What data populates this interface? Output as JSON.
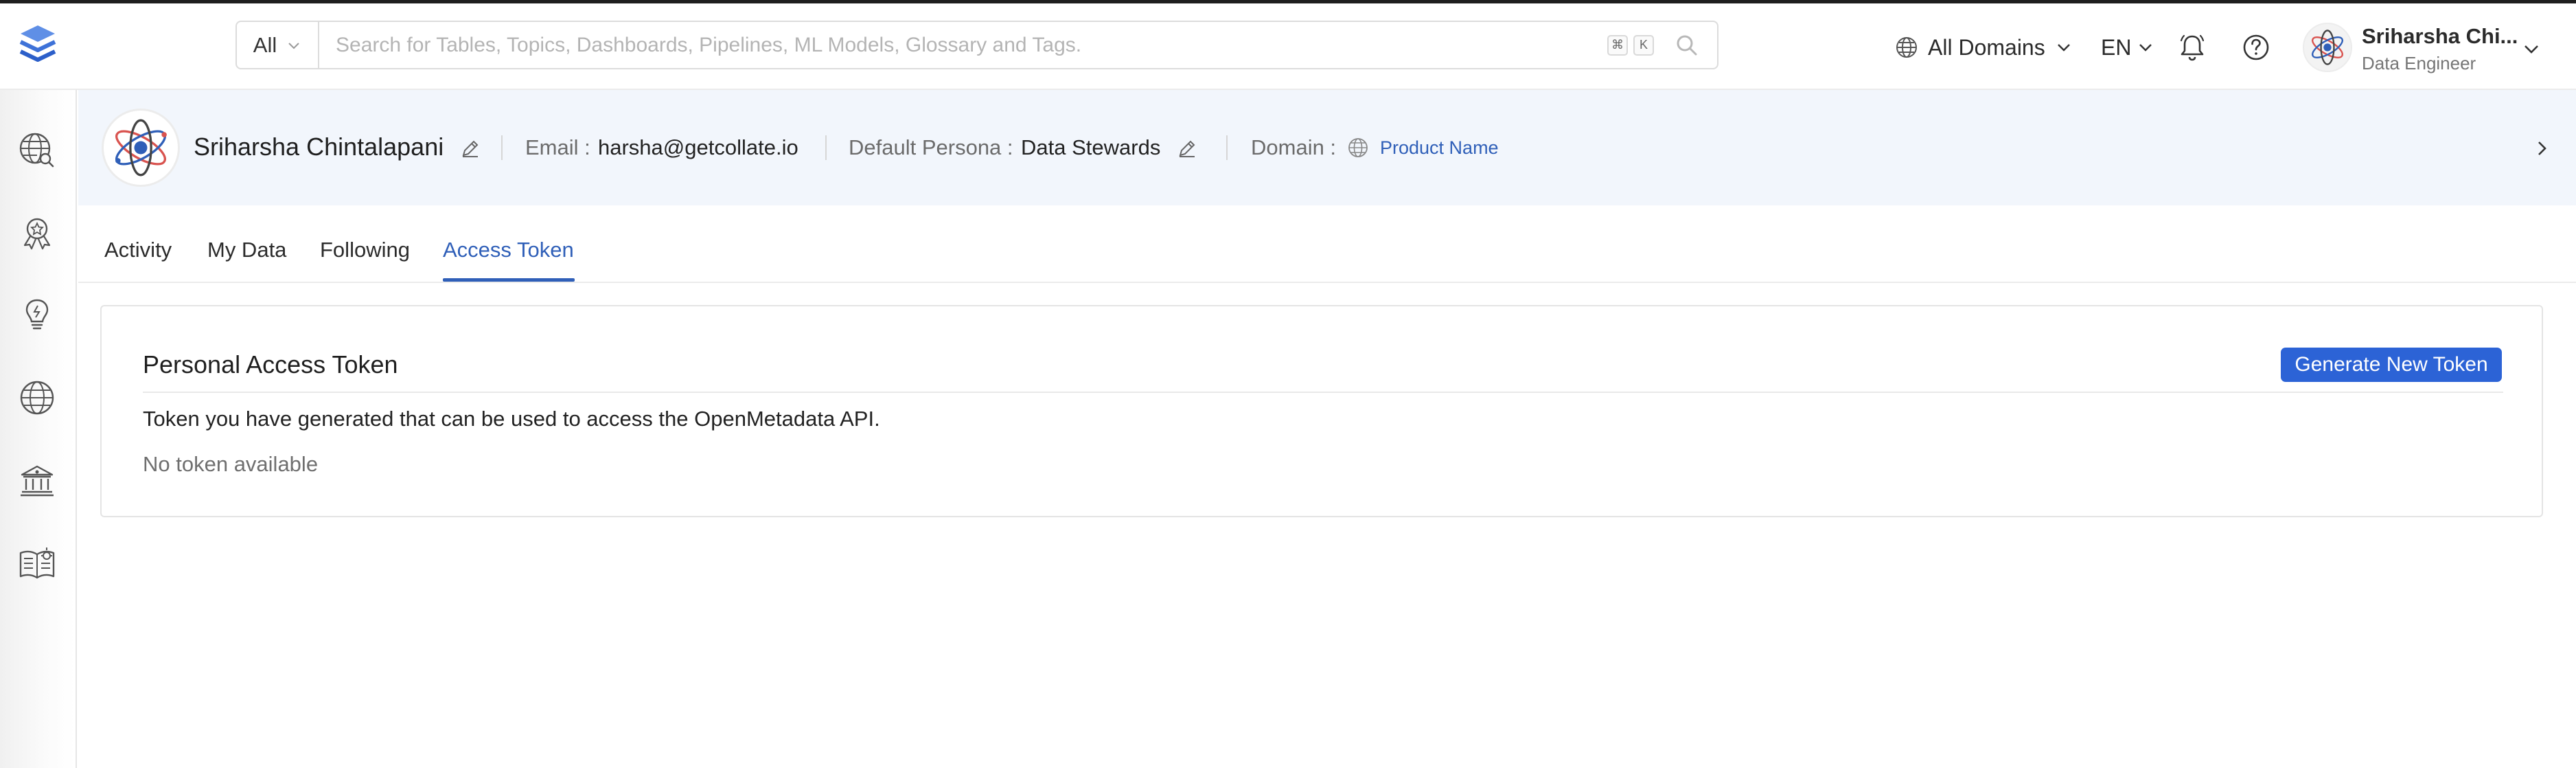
{
  "search": {
    "scope": "All",
    "placeholder": "Search for Tables, Topics, Dashboards, Pipelines, ML Models, Glossary and Tags.",
    "shortcut_keys": [
      "⌘",
      "K"
    ]
  },
  "navbar": {
    "domains_label": "All Domains",
    "language": "EN",
    "user_name": "Sriharsha Chi...",
    "user_role": "Data Engineer"
  },
  "sidebar": {
    "items": [
      {
        "icon": "explore-icon"
      },
      {
        "icon": "quality-badge-icon"
      },
      {
        "icon": "insights-bulb-icon"
      },
      {
        "icon": "domains-globe-icon"
      },
      {
        "icon": "governance-building-icon"
      },
      {
        "icon": "glossary-book-icon"
      }
    ]
  },
  "profile": {
    "name": "Sriharsha Chintalapani",
    "email_label": "Email :",
    "email": "harsha@getcollate.io",
    "persona_label": "Default Persona :",
    "persona": "Data Stewards",
    "domain_label": "Domain :",
    "domain": "Product Name"
  },
  "tabs": [
    {
      "label": "Activity",
      "active": false
    },
    {
      "label": "My Data",
      "active": false
    },
    {
      "label": "Following",
      "active": false
    },
    {
      "label": "Access Token",
      "active": true
    }
  ],
  "token_card": {
    "title": "Personal Access Token",
    "button_label": "Generate New Token",
    "description": "Token you have generated that can be used to access the OpenMetadata API.",
    "empty_text": "No token available"
  },
  "colors": {
    "accent": "#2c63d6",
    "link": "#2f5fb8",
    "header_bg": "#f2f6fc"
  }
}
